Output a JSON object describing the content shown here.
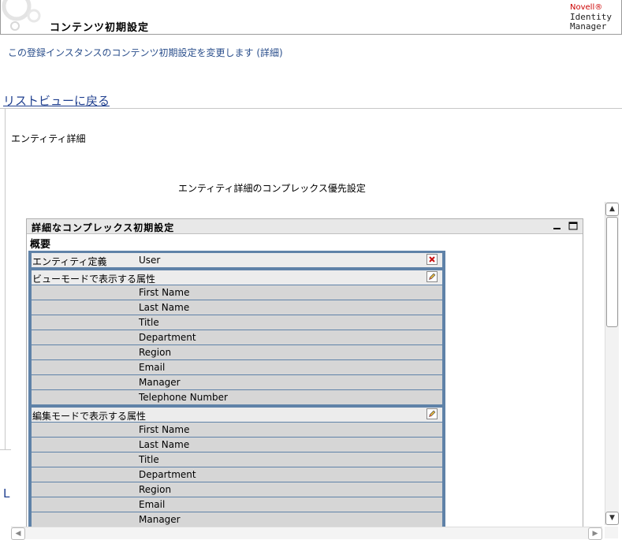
{
  "header": {
    "title": "コンテンツ初期設定",
    "logo_brand": "Novell®",
    "logo_line1": "Identity",
    "logo_line2": "Manager"
  },
  "subtitle": "この登録インスタンスのコンテンツ初期設定を変更します (詳細)",
  "back_link": "リストビューに戻る",
  "entity_detail_label": "エンティティ詳細",
  "pref_title": "エンティティ詳細のコンプレックス優先設定",
  "panel": {
    "title": "詳細なコンプレックス初期設定",
    "overview": "概要",
    "entity_definition_label": "エンティティ定義",
    "entity_definition_value": "User",
    "view_mode_label": "ビューモードで表示する属性",
    "view_mode_attributes": [
      "First Name",
      "Last Name",
      "Title",
      "Department",
      "Region",
      "Email",
      "Manager",
      "Telephone Number"
    ],
    "edit_mode_label": "編集モードで表示する属性",
    "edit_mode_attributes": [
      "First Name",
      "Last Name",
      "Title",
      "Department",
      "Region",
      "Email",
      "Manager"
    ]
  },
  "left_clipped_link": "L",
  "icons": {
    "delete": "red-x-icon",
    "edit": "pencil-icon",
    "minimize": "minimize-icon",
    "maximize": "maximize-icon"
  }
}
